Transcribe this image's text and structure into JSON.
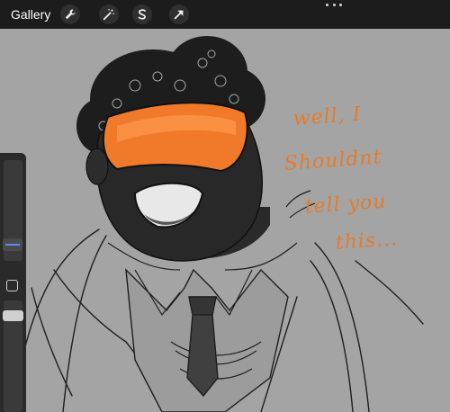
{
  "topbar": {
    "gallery_label": "Gallery",
    "tools": [
      {
        "name": "wrench-icon"
      },
      {
        "name": "magic-wand-icon"
      },
      {
        "name": "selection-icon"
      },
      {
        "name": "transform-arrow-icon"
      }
    ]
  },
  "artwork": {
    "speech_lines": [
      "well, I",
      "Shouldnt",
      "tell you",
      "this..."
    ]
  },
  "colors": {
    "toolbar_bg": "#1c1c1c",
    "canvas_bg": "#a4a4a4",
    "visor_orange": "#f07a2a",
    "text_orange": "#e57b2a",
    "size_slider_accent": "#5b8cff"
  }
}
